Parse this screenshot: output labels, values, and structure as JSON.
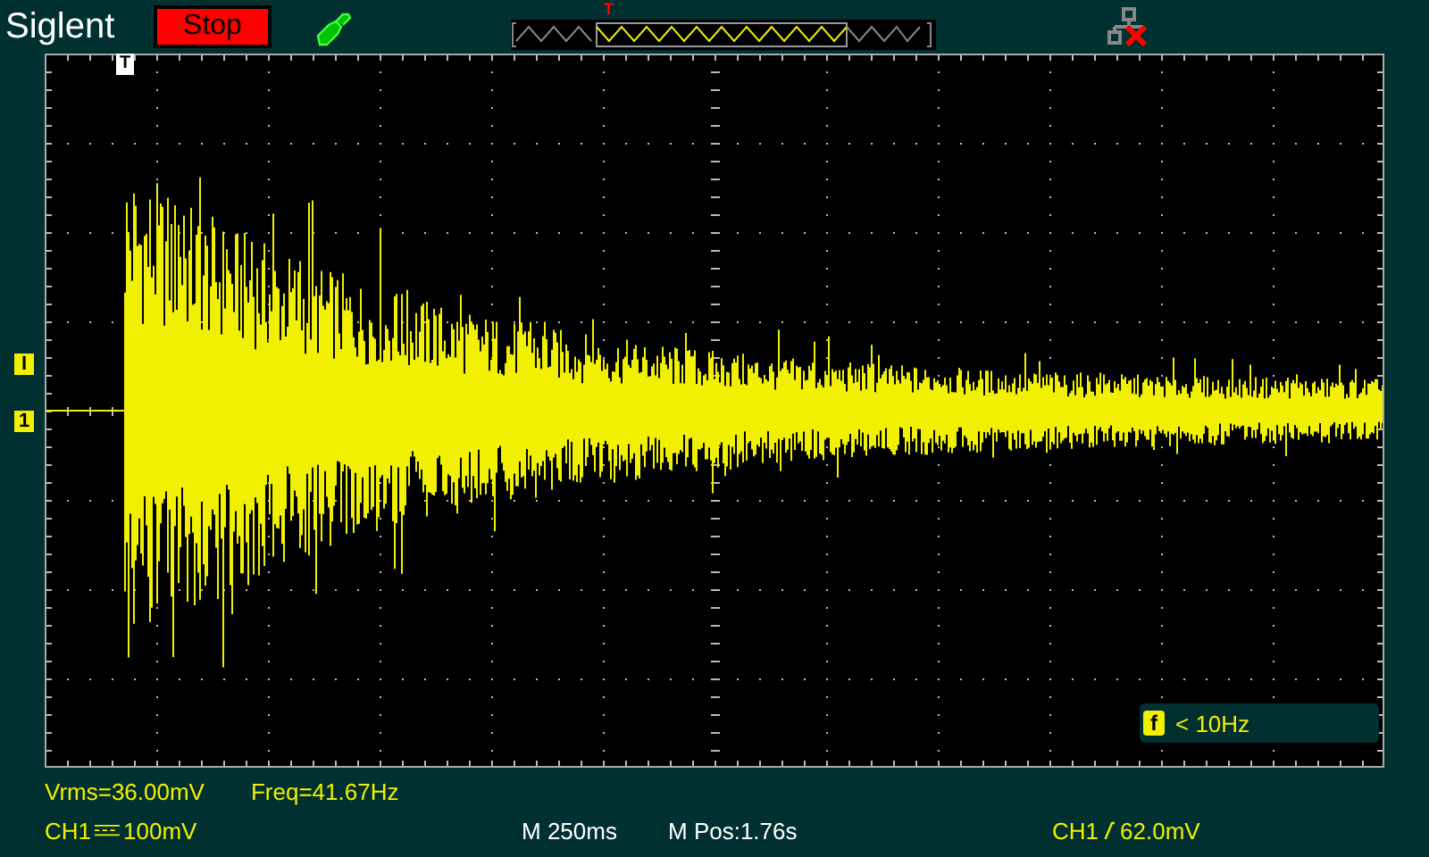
{
  "brand": "Siglent",
  "run_state": {
    "label": "Stop",
    "kind": "stopped"
  },
  "network_connected": false,
  "memory_bar": {
    "position_marker": "T"
  },
  "trigger_marker": "T",
  "channel_markers": [
    {
      "label": "I",
      "kind": "trigger_level"
    },
    {
      "label": "1",
      "kind": "channel"
    }
  ],
  "counter": {
    "icon": "f",
    "reading": "< 10Hz"
  },
  "measurements": [
    "Vrms=36.00mV",
    "Freq=41.67Hz"
  ],
  "status": {
    "channel": "CH1",
    "scale": "100mV",
    "timebase": "M 250ms",
    "position": "M Pos:1.76s",
    "trigger_source": "CH1",
    "trigger_level": "62.0mV"
  }
}
